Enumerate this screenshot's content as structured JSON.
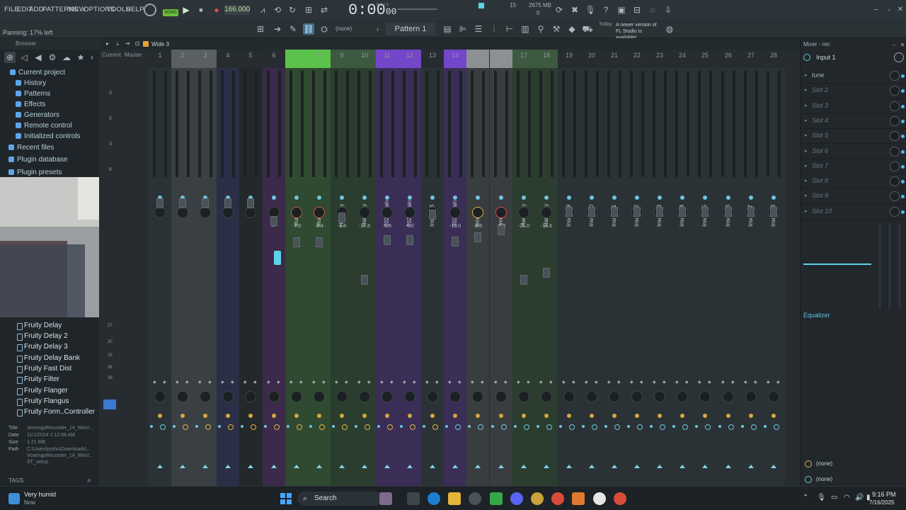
{
  "menu": [
    "FILE",
    "EDIT",
    "ADD",
    "PATTERNS",
    "VIEW",
    "OPTIONS",
    "TOOLS",
    "HELP"
  ],
  "transport": {
    "mode": "SONG",
    "tempo": "166.000",
    "time": "0:00",
    "time_sub": "00",
    "time_label": "M:S:CS",
    "cpu": "15",
    "mem": "2675 MB",
    "mem2": "0"
  },
  "hint": "Panning: 17% left",
  "toolbar2": {
    "snap": "(none)",
    "pattern": "Pattern 1",
    "news_day": "Today",
    "news_text": "A newer version of FL Studio is available!",
    "preset": "Wide 3"
  },
  "browser": {
    "title": "Browser",
    "tree": [
      "Current project",
      "History",
      "Patterns",
      "Effects",
      "Generators",
      "Remote control",
      "Initialized controls",
      "Recent files",
      "Plugin database",
      "Plugin presets"
    ],
    "plugins": [
      "Fruity Delay",
      "Fruity Delay 2",
      "Fruity Delay 3",
      "Fruity Delay Bank",
      "Fruity Fast Dist",
      "Fruity Filter",
      "Fruity Flanger",
      "Fruity Flangus",
      "Fruity Form..Controller"
    ],
    "file": {
      "title_k": "Title",
      "title_v": "VoxengoRecorder_14_WinV...",
      "date_k": "Date",
      "date_v": "11/1/2024 1:12:08 AM",
      "size_k": "Size",
      "size_v": "1.21 MB",
      "path_k": "Path",
      "path_v": "C:\\Users\\joshu\\Downloads\\...",
      "path_v2": "VoxengoRecorder_14_WinV...",
      "path_v3": "ST_setup"
    },
    "tags": "TAGS"
  },
  "mixer": {
    "title": "Mixer - rec",
    "head_current": "Current",
    "head_master": "Master",
    "scale": [
      "3",
      "0",
      "3",
      "6",
      "27",
      "30",
      "33",
      "36",
      "39"
    ],
    "strips": [
      {
        "num": "1",
        "name": "",
        "val": "",
        "color": "#2b3236"
      },
      {
        "num": "2",
        "name": "",
        "val": "",
        "color": "#3a3f43"
      },
      {
        "num": "3",
        "name": "",
        "val": "",
        "color": "#3a3f43"
      },
      {
        "num": "4",
        "name": "",
        "val": "",
        "color": "#2a2f45"
      },
      {
        "num": "5",
        "name": "",
        "val": "",
        "color": "#23282b"
      },
      {
        "num": "6",
        "name": "rec",
        "val": "",
        "color": "#3b2a4a"
      },
      {
        "num": "7",
        "name": "stunna",
        "val": "-7.3",
        "color": "#2f4a30"
      },
      {
        "num": "8",
        "name": "stunna",
        "val": "-8.4",
        "color": "#2f4a30"
      },
      {
        "num": "9",
        "name": "Harmony",
        "val": "-1.8",
        "color": "#2b3d2f"
      },
      {
        "num": "10",
        "name": "Harmony",
        "val": "-17.6",
        "color": "#2b3d2f"
      },
      {
        "num": "11",
        "name": "2020 Main",
        "val": "-9.5",
        "color": "#3a2e57"
      },
      {
        "num": "12",
        "name": "2020 Main",
        "val": "-9.2",
        "color": "#3a2e57"
      },
      {
        "num": "13",
        "name": "Insert 13",
        "val": "",
        "color": "#2b3236"
      },
      {
        "num": "14",
        "name": "2020 Main",
        "val": "-10.0",
        "color": "#3a2e57"
      },
      {
        "num": "15",
        "name": "smd",
        "val": "-8.6",
        "color": "#3a3d40"
      },
      {
        "num": "16",
        "name": "smd",
        "val": "-5.8",
        "color": "#3a3d40"
      },
      {
        "num": "17",
        "name": "Harmony",
        "val": "-21.0",
        "color": "#2b3d2f"
      },
      {
        "num": "18",
        "name": "Harmony",
        "val": "-18.6",
        "color": "#2b3d2f"
      },
      {
        "num": "19",
        "name": "Insert 19",
        "val": "",
        "color": "#2b3236"
      },
      {
        "num": "20",
        "name": "Insert 20",
        "val": "",
        "color": "#2b3236"
      },
      {
        "num": "21",
        "name": "Insert 21",
        "val": "",
        "color": "#2b3236"
      },
      {
        "num": "22",
        "name": "Insert 22",
        "val": "",
        "color": "#2b3236"
      },
      {
        "num": "23",
        "name": "Insert 23",
        "val": "",
        "color": "#2b3236"
      },
      {
        "num": "24",
        "name": "Insert 24",
        "val": "",
        "color": "#2b3236"
      },
      {
        "num": "25",
        "name": "Insert 25",
        "val": "",
        "color": "#2b3236"
      },
      {
        "num": "26",
        "name": "Insert 26",
        "val": "",
        "color": "#2b3236"
      },
      {
        "num": "27",
        "name": "Insert 27",
        "val": "",
        "color": "#2b3236"
      },
      {
        "num": "28",
        "name": "Insert 28",
        "val": "",
        "color": "#2b3236"
      }
    ]
  },
  "rpanel": {
    "input": "Input 1",
    "slots": [
      "tune",
      "Slot 2",
      "Slot 3",
      "Slot 4",
      "Slot 5",
      "Slot 6",
      "Slot 7",
      "Slot 8",
      "Slot 9",
      "Slot 10"
    ],
    "eq": "Equalizer",
    "out1": "(none)",
    "out2": "(none)"
  },
  "taskbar": {
    "weather_temp": "Very humid",
    "weather_sub": "Now",
    "search": "Search",
    "time": "9:16 PM",
    "date": "7/16/2025"
  }
}
